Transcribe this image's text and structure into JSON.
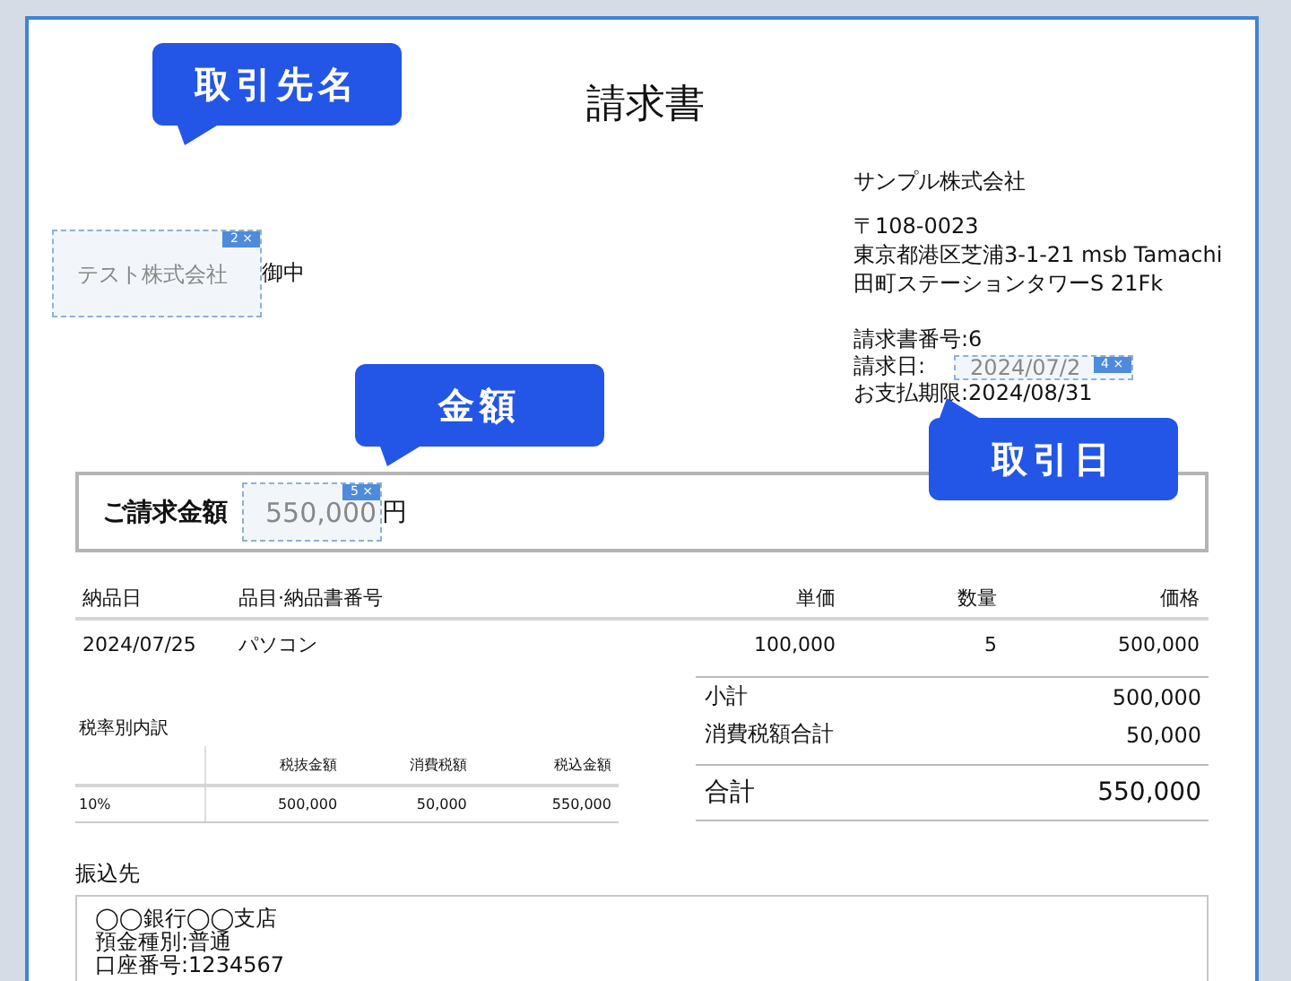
{
  "document": {
    "title": "請求書",
    "customer": {
      "placeholder": "テスト株式会社",
      "tag": "2 ×",
      "callout": "取引先名",
      "suffix": "御中"
    },
    "issuer": {
      "company": "サンプル株式会社",
      "address_lines": [
        "〒108-0023",
        "東京都港区芝浦3-1-21 msb Tamachi",
        "田町ステーションタワーS 21Fk"
      ]
    },
    "meta": [
      {
        "label": "請求書番号:",
        "value": "6"
      },
      {
        "label": "請求日:",
        "field": {
          "placeholder": "2024/07/2",
          "tag": "4 ×",
          "callout": "取引日"
        }
      },
      {
        "label": "お支払期限:",
        "value": "2024/08/31"
      }
    ],
    "amount": {
      "label": "ご請求金額",
      "field": {
        "placeholder": "550,000",
        "tag": "5 ×",
        "callout": "金額"
      },
      "unit": "円"
    },
    "items": {
      "columns": [
        "納品日",
        "品目·納品書番号",
        "単価",
        "数量",
        "価格"
      ],
      "rows": [
        [
          "2024/07/25",
          "パソコン",
          "100,000",
          "5",
          "500,000"
        ]
      ]
    },
    "tax_breakdown": {
      "title": "税率別内訳",
      "columns": [
        "",
        "税抜金額",
        "消費税額",
        "税込金額"
      ],
      "rows": [
        [
          "10%",
          "500,000",
          "50,000",
          "550,000"
        ]
      ]
    },
    "totals": [
      {
        "label": "小計",
        "value": "500,000",
        "kind": "sub"
      },
      {
        "label": "消費税額合計",
        "value": "50,000",
        "kind": "sub"
      },
      {
        "label": "合計",
        "value": "550,000",
        "kind": "grand"
      }
    ],
    "bank": {
      "title": "振込先",
      "lines": [
        "◯◯銀行◯◯支店",
        "預金種別:普通",
        "口座番号:1234567"
      ]
    }
  }
}
